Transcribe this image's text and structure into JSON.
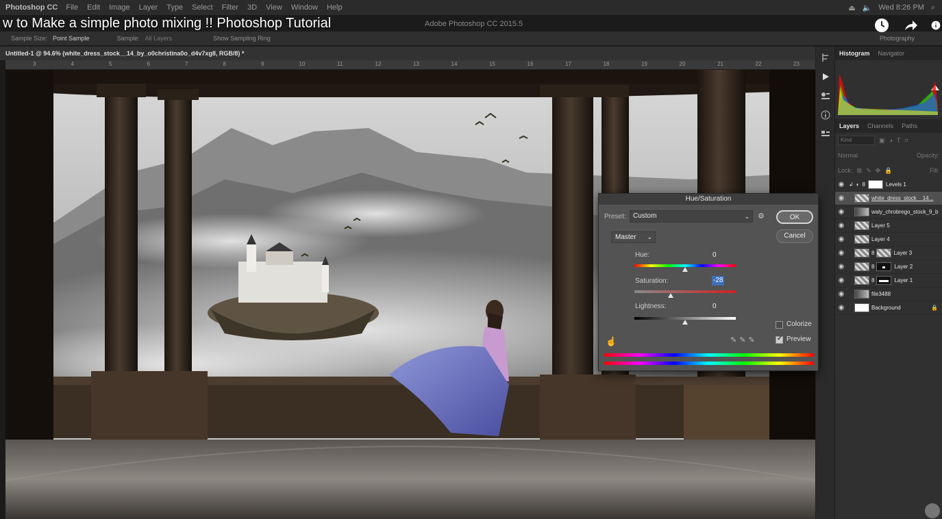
{
  "menubar": {
    "app": "Photoshop CC",
    "items": [
      "File",
      "Edit",
      "Image",
      "Layer",
      "Type",
      "Select",
      "Filter",
      "3D",
      "View",
      "Window",
      "Help"
    ],
    "clock": "Wed 8:26 PM"
  },
  "video": {
    "title": "w to Make a simple photo mixing !! Photoshop Tutorial"
  },
  "ps_window_title": "Adobe Photoshop CC 2015.5",
  "options": {
    "sample_size_label": "Sample Size:",
    "sample_size_value": "Point Sample",
    "sample_label": "Sample:",
    "sample_value": "All Layers",
    "show_ring": "Show Sampling Ring",
    "workspace": "Photography"
  },
  "document": {
    "tab": "Untitled-1 @ 94.6% (white_dress_stock__14_by_o0christina0o_d4v7xg8, RGB/8) *"
  },
  "ruler": [
    "3",
    "4",
    "5",
    "6",
    "7",
    "8",
    "9",
    "10",
    "11",
    "12",
    "13",
    "14",
    "15",
    "16",
    "17",
    "18",
    "19",
    "20",
    "21",
    "22",
    "23"
  ],
  "panels": {
    "top_tabs": [
      "Histogram",
      "Navigator"
    ],
    "layer_tabs": [
      "Layers",
      "Channels",
      "Paths"
    ],
    "find_placeholder": "Kind",
    "blend_mode": "Normal",
    "opacity_label": "Opacity:",
    "lock_label": "Lock:",
    "fill_label": "Fill:",
    "layers": [
      {
        "name": "Levels 1"
      },
      {
        "name": "white_dress_stock__14..."
      },
      {
        "name": "waly_chrobrego_stock_9_b"
      },
      {
        "name": "Layer 5"
      },
      {
        "name": "Layer 4"
      },
      {
        "name": "Layer 3"
      },
      {
        "name": "Layer 2"
      },
      {
        "name": "Layer 1"
      },
      {
        "name": "file3488"
      },
      {
        "name": "Background"
      }
    ]
  },
  "dialog": {
    "title": "Hue/Saturation",
    "preset_label": "Preset:",
    "preset_value": "Custom",
    "ok_label": "OK",
    "cancel_label": "Cancel",
    "channel": "Master",
    "hue_label": "Hue:",
    "hue_value": "0",
    "saturation_label": "Saturation:",
    "saturation_value": "-28",
    "lightness_label": "Lightness:",
    "lightness_value": "0",
    "colorize_label": "Colorize",
    "preview_label": "Preview",
    "colorize": false,
    "preview": true
  }
}
